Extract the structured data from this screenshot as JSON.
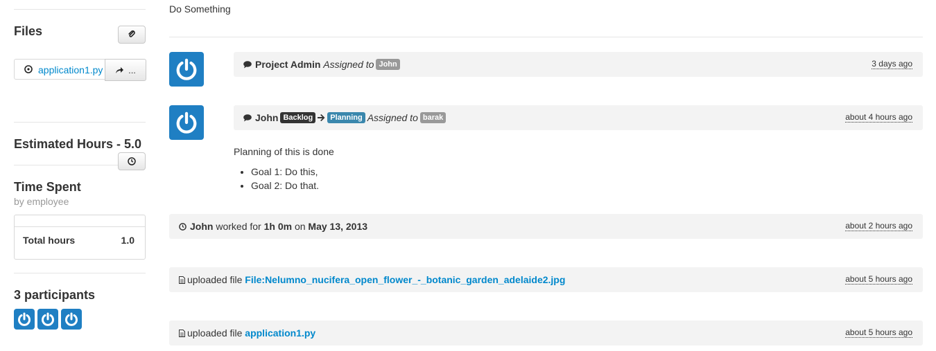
{
  "top": {
    "text": "Do Something"
  },
  "sidebar": {
    "files": {
      "title": "Files",
      "attach_icon": "paperclip-icon",
      "file": {
        "icon": "clock-circle-icon",
        "name": "application1.py",
        "share_icon": "share-arrow-icon",
        "more": "..."
      }
    },
    "estimated": {
      "title": "Estimated Hours - 5.0",
      "button_icon": "clock-icon"
    },
    "time_spent": {
      "title": "Time Spent",
      "subtitle": "by employee",
      "row": {
        "label": "Total hours",
        "value": "1.0"
      }
    },
    "participants": {
      "title": "3 participants",
      "count": 3
    }
  },
  "activity": {
    "item1": {
      "user": "Project Admin",
      "action": "Assigned to",
      "assignee": "John",
      "time": "3 days ago"
    },
    "item2": {
      "user": "John",
      "from_status": "Backlog",
      "to_status": "Planning",
      "action": "Assigned to",
      "assignee": "barak",
      "time": "about 4 hours ago",
      "comment": "Planning of this is done",
      "goals": [
        "Goal 1: Do this,",
        "Goal 2: Do that."
      ]
    },
    "item3": {
      "user": "John",
      "worked_for": "worked for",
      "duration": "1h 0m",
      "on": "on",
      "date": "May 13, 2013",
      "time": "about 2 hours ago"
    },
    "item4": {
      "action": "uploaded file",
      "file": "File:Nelumno_nucifera_open_flower_-_botanic_garden_adelaide2.jpg",
      "time": "about 5 hours ago"
    },
    "item5": {
      "action": "uploaded file",
      "file": "application1.py",
      "time": "about 5 hours ago"
    }
  },
  "colors": {
    "avatar": "#1f7fc3",
    "link": "#0088cc",
    "bar": "#f3f3f3",
    "label_gray": "#999999",
    "label_dark": "#333333",
    "label_blue": "#3a87ad"
  }
}
